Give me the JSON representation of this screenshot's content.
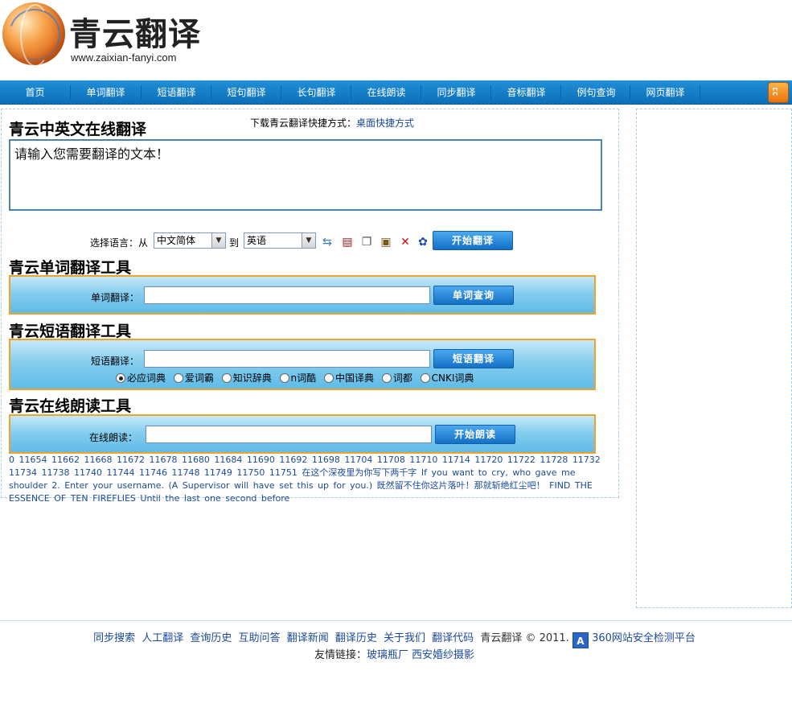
{
  "header": {
    "logo_text": "青云翻译",
    "logo_url": "www.zaixian-fanyi.com"
  },
  "nav": {
    "items": [
      "首页",
      "单词翻译",
      "短语翻译",
      "短句翻译",
      "长句翻译",
      "在线朗读",
      "同步翻译",
      "音标翻译",
      "例句查询",
      "网页翻译"
    ],
    "rss_icon": "rss-icon"
  },
  "translator": {
    "title": "青云中英文在线翻译",
    "download_prefix": "下载青云翻译快捷方式：",
    "download_link": "桌面快捷方式",
    "input_value": "请输入您需要翻译的文本！",
    "lang_label": "选择语言：从",
    "from_lang": "中文简体",
    "to_label": "到",
    "to_lang": "英语",
    "start_button": "开始翻译",
    "icons": [
      "swap-icon",
      "book-icon",
      "copy-icon",
      "paste-icon",
      "clear-icon",
      "paw-icon"
    ]
  },
  "word_tool": {
    "title": "青云单词翻译工具",
    "label": "单词翻译：",
    "input_value": "",
    "button": "单词查询"
  },
  "phrase_tool": {
    "title": "青云短语翻译工具",
    "label": "短语翻译：",
    "input_value": "",
    "button": "短语翻译",
    "dictionaries": [
      "必应词典",
      "爱词霸",
      "知识辞典",
      "n词酷",
      "中国译典",
      "词都",
      "CNKI词典"
    ],
    "selected_dictionary": "必应词典"
  },
  "read_tool": {
    "title": "青云在线朗读工具",
    "label": "在线朗读：",
    "input_value": "",
    "button": "开始朗读"
  },
  "history": {
    "text": "0  11654  11662  11668  11672  11678  11680  11684  11690  11692  11698  11704  11708  11710  11714  11720  11722  11728  11732  11734  11738  11740  11744  11746  11748  11749  11750  11751  在这个深夜里为你写下两千字 If you want to cry, who gave me shoulder 2. Enter your username. (A Supervisor will have set this up for you.) 既然留不住你这片落叶！那就斩绝红尘吧！ FIND THE ESSENCE OF TEN FIREFLIES Until the last one second before"
  },
  "footer": {
    "links": [
      "同步搜索",
      "人工翻译",
      "查询历史",
      "互助问答",
      "翻译新闻",
      "翻译历史",
      "关于我们",
      "翻译代码"
    ],
    "brand": "青云翻译 © 2011.",
    "cert_icon": "A",
    "cert_link": "360网站安全检测平台",
    "friend_label": "友情链接：",
    "friend_links": [
      "玻璃瓶厂",
      "西安婚纱摄影"
    ]
  }
}
